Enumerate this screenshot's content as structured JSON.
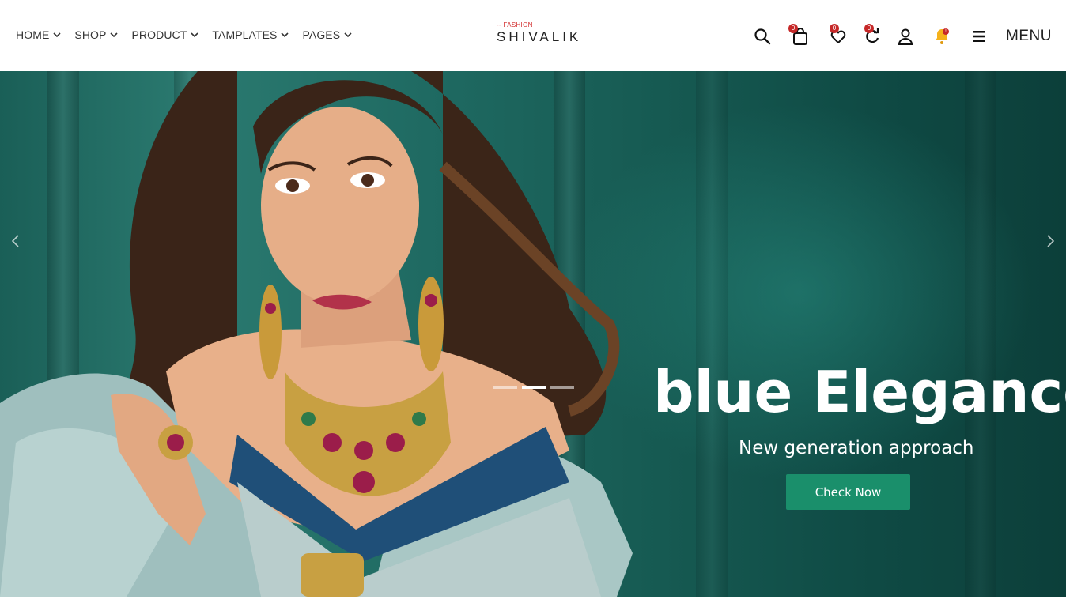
{
  "nav": {
    "items": [
      {
        "label": "HOME"
      },
      {
        "label": "SHOP"
      },
      {
        "label": "PRODUCT"
      },
      {
        "label": "TAMPLATES"
      },
      {
        "label": "PAGES"
      }
    ]
  },
  "logo": {
    "tagline": "-- FASHION",
    "name": "SHIVALIK"
  },
  "actions": {
    "search_icon": "search-icon",
    "cart_count": "0",
    "wishlist_count": "0",
    "compare_count": "0",
    "notification_badge": "!",
    "menu_label": "MENU"
  },
  "hero": {
    "title": "blue Elegance",
    "subtitle": "New generation approach",
    "button_label": "Check Now",
    "slide_count": 3,
    "active_slide": 2
  },
  "colors": {
    "accent_button": "#1a8f6b",
    "badge": "#c62828",
    "hero_background": "#1a5f57"
  }
}
